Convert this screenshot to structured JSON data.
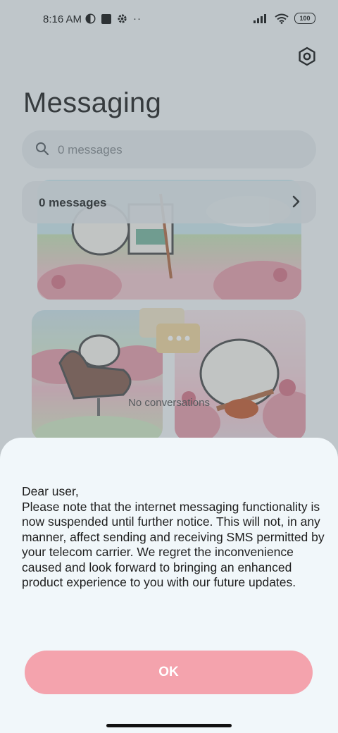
{
  "status_bar": {
    "time": "8:16 AM",
    "battery": "100",
    "icons_left": [
      "app-icon",
      "stop-icon",
      "gear-icon",
      "more-dots-icon"
    ],
    "icons_right": [
      "signal-icon",
      "wifi-icon",
      "battery-icon"
    ]
  },
  "header": {
    "title": "Messaging",
    "settings_icon": "settings-icon"
  },
  "search": {
    "placeholder": "0 messages"
  },
  "messages_row": {
    "label": "0 messages"
  },
  "empty_state": {
    "text": "No conversations"
  },
  "dialog": {
    "message": "Dear user,\nPlease note that the internet messaging functionality is now suspended until further notice. This will not, in any manner, affect sending and receiving SMS permitted by your telecom carrier. We regret the inconvenience caused and look forward to bringing an enhanced product experience to you with our future updates.",
    "ok_label": "OK"
  },
  "colors": {
    "accent": "#f4a3ad",
    "sheet_bg": "#f1f7fa",
    "dim_overlay": "rgba(80,95,105,0.32)"
  }
}
